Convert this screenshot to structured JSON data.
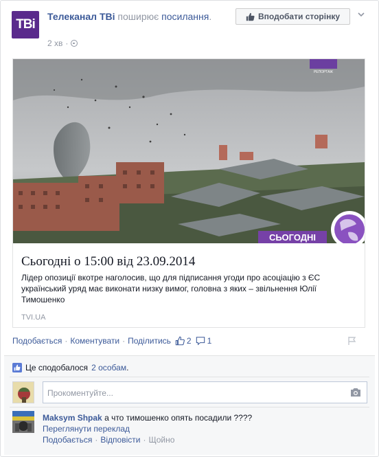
{
  "post": {
    "page_name": "Телеканал ТВі",
    "logo_text": "ТВі",
    "action_text": "поширює",
    "link_text": "посилання",
    "link_period": ".",
    "time": "2 хв",
    "dot": "·",
    "like_page_label": "Вподобати сторінку"
  },
  "article": {
    "image_badge": "СЬОГОДНІ",
    "image_tag": "РЕПОРТАЖ",
    "title": "Сьогодні о 15:00 від 23.09.2014",
    "description": "Лідер опозиції вкотре наголосив, що для підписання угоди про асоціацію з ЄС український уряд має виконати низку вимог, головна з яких – звільнення Юлії Тимошенко",
    "source": "TVI.UA"
  },
  "actions": {
    "like": "Подобається",
    "comment": "Коментувати",
    "share": "Поділитись",
    "sep": "·",
    "likes_count": "2",
    "comments_count": "1"
  },
  "ufi": {
    "likes_prefix": "Це сподобалося",
    "likes_link": "2 особам",
    "likes_suffix": ".",
    "comment_placeholder": "Прокоментуйте..."
  },
  "comment": {
    "author": "Maksym Shpak",
    "text": "а что тимошенко опять посадили ????",
    "see_translation": "Переглянути переклад",
    "like": "Подобається",
    "reply": "Відповісти",
    "time": "Щойно",
    "sep": "·"
  },
  "colors": {
    "link": "#3b5998",
    "muted": "#9197a3",
    "brand": "#5a2a8c"
  },
  "icons": {
    "like_page": "thumbs-up-icon",
    "privacy": "globe-icon",
    "menu": "chevron-down-icon",
    "like_count": "thumbs-up-icon",
    "comment_count": "speech-bubble-icon",
    "report": "flag-icon",
    "likes_row": "thumbs-up-icon",
    "attach_photo": "camera-icon"
  }
}
